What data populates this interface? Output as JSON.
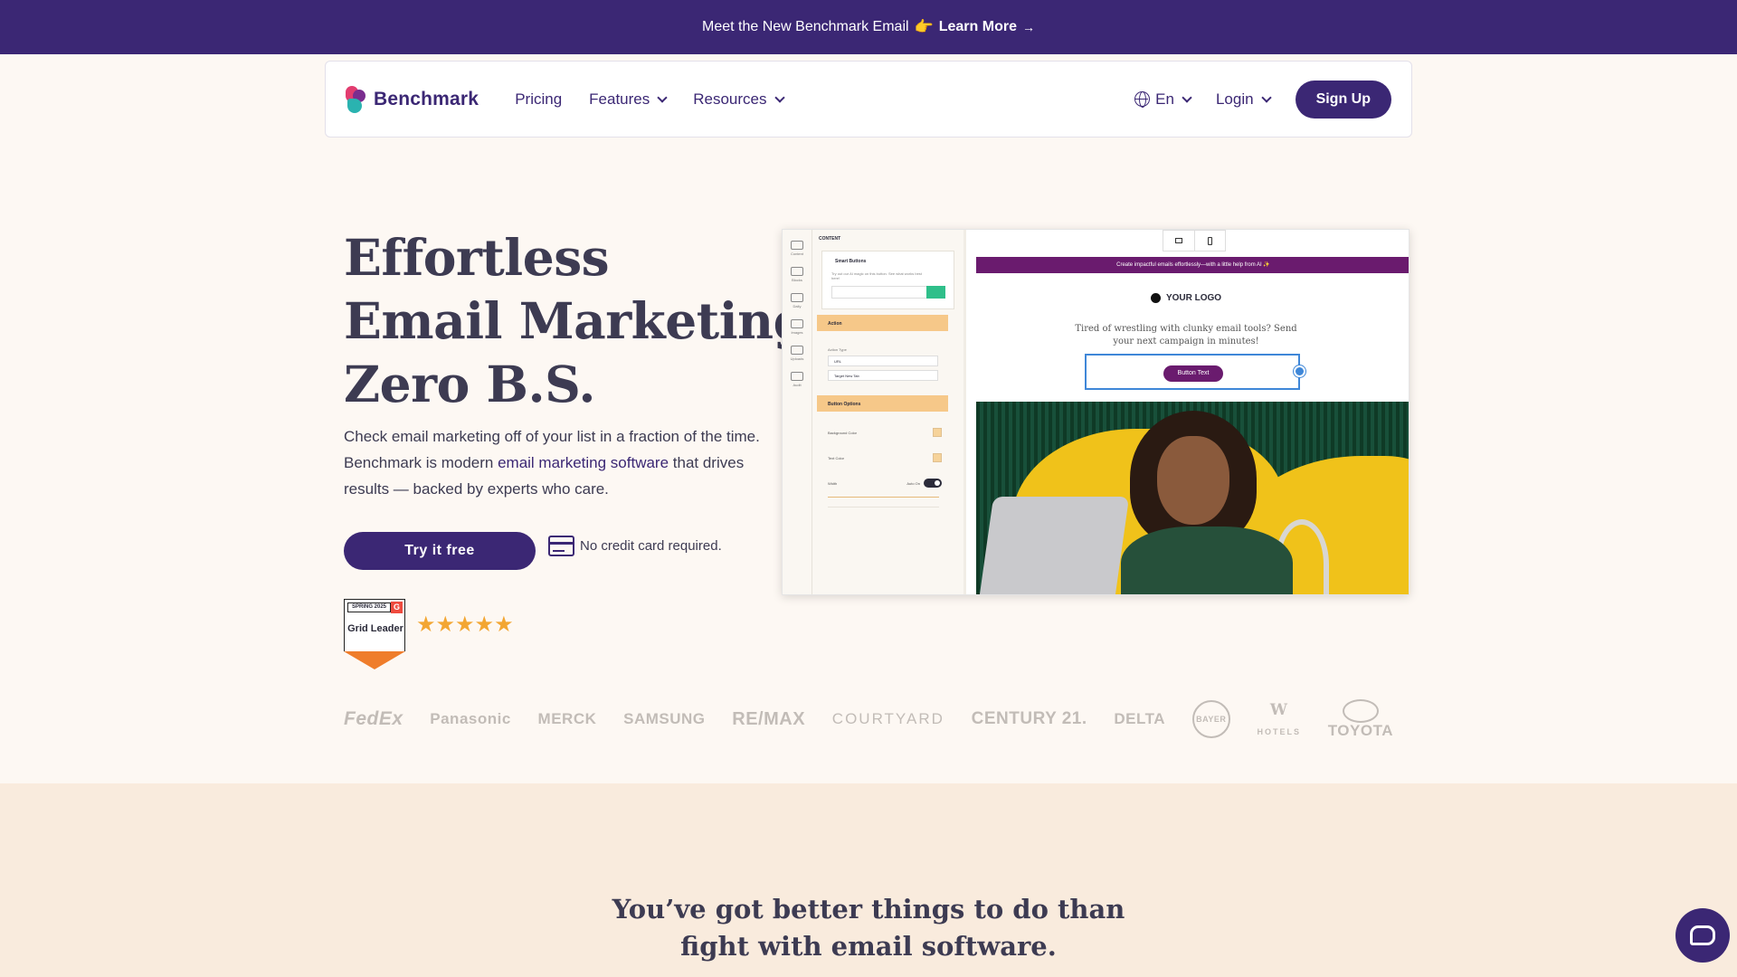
{
  "announcement": {
    "text": "Meet the New Benchmark Email",
    "emoji": "👉",
    "link_label": "Learn More",
    "arrow": "→"
  },
  "nav": {
    "brand": "Benchmark",
    "links": [
      "Pricing",
      "Features",
      "Resources"
    ],
    "language": "En",
    "login": "Login",
    "signup": "Sign Up"
  },
  "hero": {
    "title_lines": [
      "Effortless",
      "Email Marketing.",
      "Zero B.S."
    ],
    "desc_1": "Check email marketing off of your list in a fraction of the time. Benchmark is modern ",
    "desc_link": "email marketing software",
    "desc_2": " that drives results — backed by experts who care.",
    "cta": "Try it free",
    "no_card": "No credit card required.",
    "badge_season": "SPRING 2025",
    "badge_g": "G",
    "badge_text": "Grid Leader",
    "rating_stars": 5,
    "stars": "★★★★★"
  },
  "mock": {
    "panel_head": "CONTENT",
    "card_title": "Smart Buttons",
    "card_desc": "Try out our AI magic on this button. See what works best here!",
    "action_bar": "Action",
    "action_type_label": "Action Type",
    "url_field": "URL",
    "target_field": "Target    New Tab",
    "options_bar": "Button Options",
    "bg_color": "Background Color",
    "text_color": "Text Color",
    "width_label": "Width",
    "auto_on": "Auto On",
    "rail": [
      "Content",
      "Blocks",
      "Daily",
      "Images",
      "Uploads",
      "Audit"
    ],
    "email_bar": "Create impactful emails effortlessly—with a little help from AI ✨",
    "email_logo": "YOUR LOGO",
    "email_copy_1": "Tired of wrestling with clunky email tools? Send",
    "email_copy_2": "your next campaign in minutes!",
    "email_button": "Button Text"
  },
  "logos": [
    "FedEx",
    "Panasonic",
    "MERCK",
    "SAMSUNG",
    "RE/MAX",
    "COURTYARD",
    "CENTURY 21.",
    "DELTA",
    "BAYER",
    "W",
    "HOTELS",
    "TOYOTA"
  ],
  "section": {
    "title_lines": [
      "You’ve got better things to do than",
      "fight with email software."
    ]
  },
  "colors": {
    "brand": "#3b2774",
    "accent_orange": "#f3a632",
    "cream": "#fdf8f3"
  }
}
